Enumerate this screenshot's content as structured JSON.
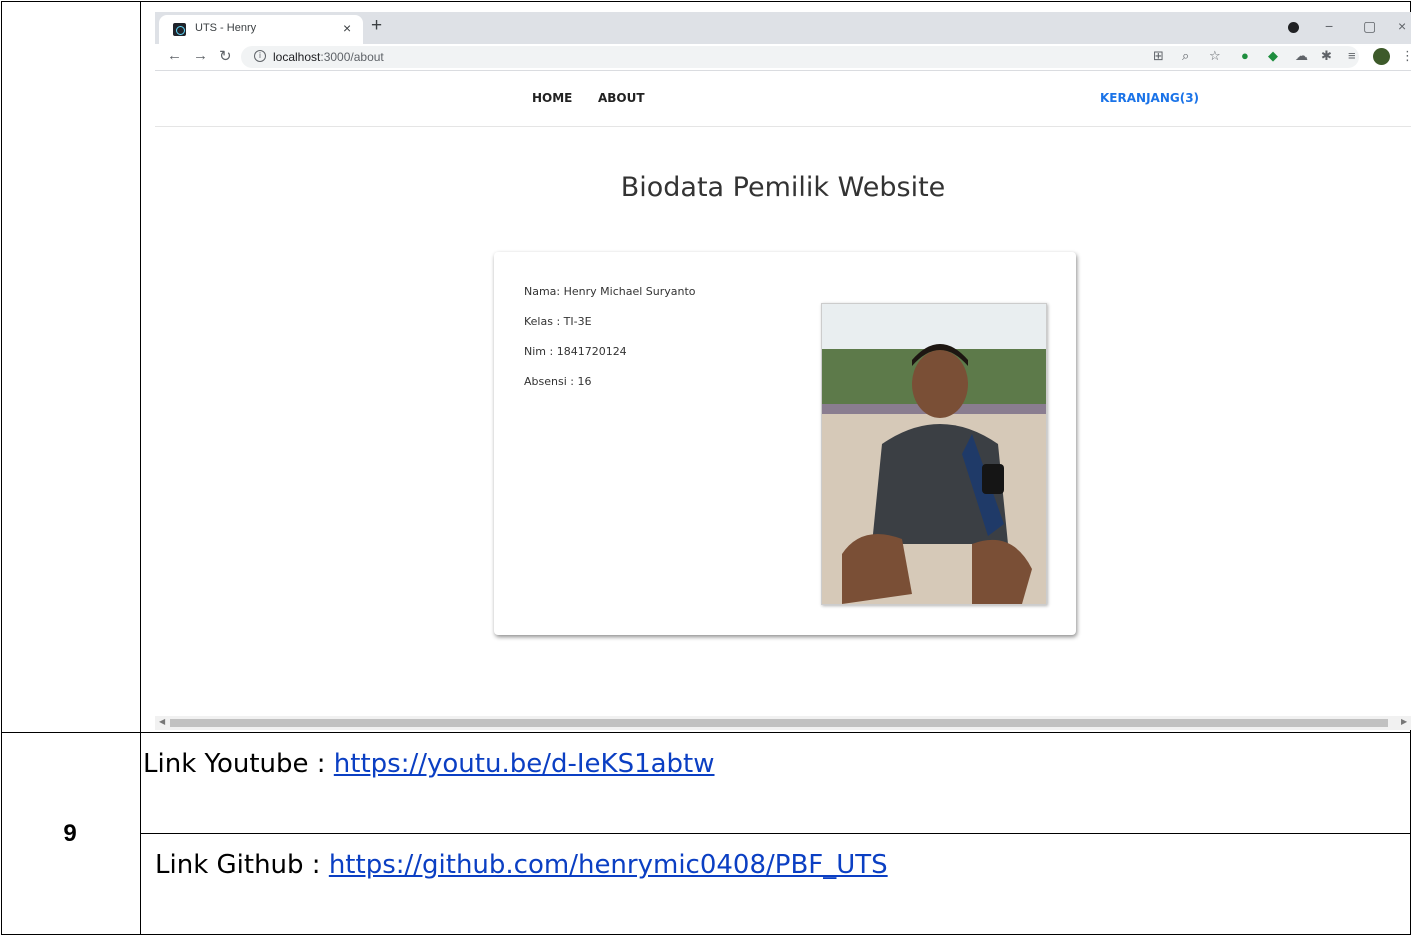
{
  "browser": {
    "tab_title": "UTS - Henry",
    "tab_close": "×",
    "new_tab": "+",
    "url_host": "localhost",
    "url_path": ":3000/about",
    "window_controls": [
      "−",
      "▢",
      "×"
    ],
    "nav_icons": [
      "back-arrow-icon",
      "forward-arrow-icon",
      "reload-icon"
    ]
  },
  "app": {
    "nav": {
      "home": "HOME",
      "about": "ABOUT",
      "cart": "KERANJANG(3)"
    },
    "heading": "Biodata Pemilik Website",
    "bio": {
      "nama": "Nama: Henry Michael Suryanto",
      "kelas": "Kelas : TI-3E",
      "nim": "Nim : 1841720124",
      "absensi": "Absensi : 16"
    }
  },
  "document": {
    "row_number": "9",
    "youtube_label": "Link Youtube : ",
    "youtube_url": "https://youtu.be/d-IeKS1abtw",
    "github_label": "Link Github : ",
    "github_url": "https://github.com/henrymic0408/PBF_UTS"
  },
  "colors": {
    "link": "#0b3fc3",
    "cart_link": "#1a73e8",
    "tabbar": "#dee1e6"
  }
}
